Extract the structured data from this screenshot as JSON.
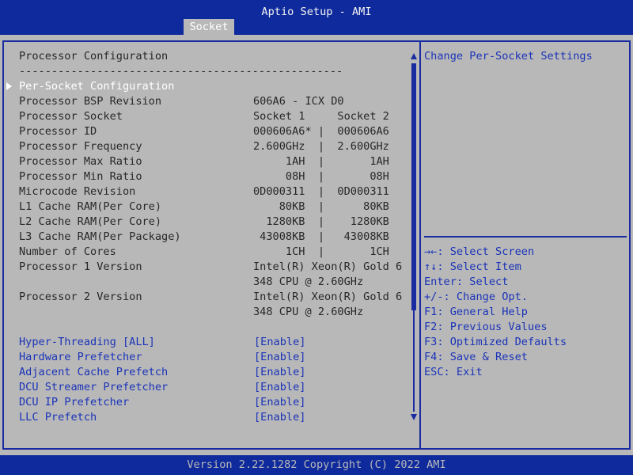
{
  "header": {
    "title": "Aptio Setup - AMI",
    "tab": "Socket"
  },
  "section": {
    "title": "Processor Configuration",
    "separator": "--------------------------------------------------"
  },
  "submenu": {
    "label": "Per-Socket Configuration"
  },
  "info_rows": [
    {
      "label": "Processor BSP Revision",
      "value": "606A6 - ICX D0"
    },
    {
      "label": "Processor Socket",
      "value": "Socket 1     Socket 2"
    },
    {
      "label": "Processor ID",
      "value": "000606A6* |  000606A6"
    },
    {
      "label": "Processor Frequency",
      "value": "2.600GHz  |  2.600GHz"
    },
    {
      "label": "Processor Max Ratio",
      "value": "     1AH  |       1AH"
    },
    {
      "label": "Processor Min Ratio",
      "value": "     08H  |       08H"
    },
    {
      "label": "Microcode Revision",
      "value": "0D000311  |  0D000311"
    },
    {
      "label": "L1 Cache RAM(Per Core)",
      "value": "    80KB  |      80KB"
    },
    {
      "label": "L2 Cache RAM(Per Core)",
      "value": "  1280KB  |    1280KB"
    },
    {
      "label": "L3 Cache RAM(Per Package)",
      "value": " 43008KB  |   43008KB"
    },
    {
      "label": "Number of Cores",
      "value": "     1CH  |       1CH"
    },
    {
      "label": "Processor 1 Version",
      "value": "Intel(R) Xeon(R) Gold 6"
    },
    {
      "label": "",
      "value": "348 CPU @ 2.60GHz"
    },
    {
      "label": "Processor 2 Version",
      "value": "Intel(R) Xeon(R) Gold 6"
    },
    {
      "label": "",
      "value": "348 CPU @ 2.60GHz"
    }
  ],
  "options": [
    {
      "label": "Hyper-Threading [ALL]",
      "value": "[Enable]"
    },
    {
      "label": "Hardware Prefetcher",
      "value": "[Enable]"
    },
    {
      "label": "Adjacent Cache Prefetch",
      "value": "[Enable]"
    },
    {
      "label": "DCU Streamer Prefetcher",
      "value": "[Enable]"
    },
    {
      "label": "DCU IP Prefetcher",
      "value": "[Enable]"
    },
    {
      "label": "LLC Prefetch",
      "value": "[Enable]"
    }
  ],
  "help": {
    "description": "Change Per-Socket Settings",
    "keys": [
      "→←: Select Screen",
      "↑↓: Select Item",
      "Enter: Select",
      "+/-: Change Opt.",
      "F1: General Help",
      "F2: Previous Values",
      "F3: Optimized Defaults",
      "F4: Save & Reset",
      "ESC: Exit"
    ]
  },
  "footer": {
    "text": "Version 2.22.1282 Copyright (C) 2022 AMI"
  },
  "colors": {
    "background": "#b8b8b8",
    "bar": "#0f2a9c",
    "border": "#1a2aa0",
    "text": "#272727",
    "option_text": "#1a33b8",
    "highlight": "#ffffff"
  }
}
